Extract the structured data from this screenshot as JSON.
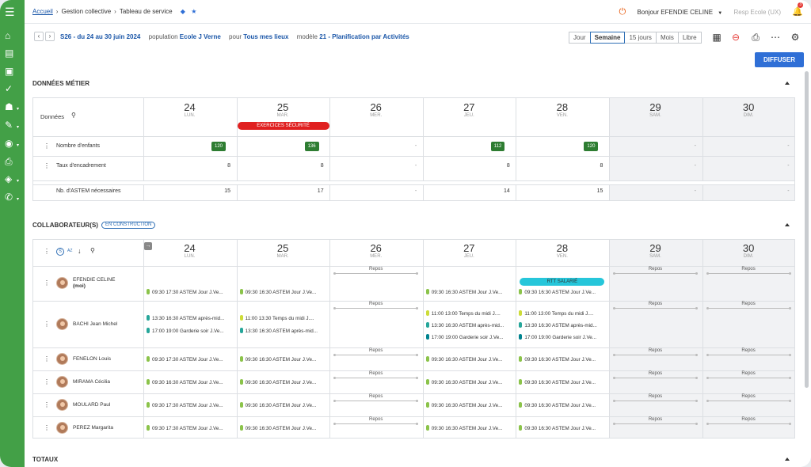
{
  "sidebar": {
    "icons": [
      "menu-icon",
      "home-icon",
      "contacts-icon",
      "gallery-icon",
      "check-icon",
      "team-icon",
      "person-edit-icon",
      "eye-icon",
      "print-icon",
      "user-shield-icon",
      "wrench-icon"
    ]
  },
  "topbar": {
    "breadcrumb": [
      "Accueil",
      "Gestion collective",
      "Tableau de service"
    ],
    "greeting": "Bonjour EFENDIE CELINE",
    "role": "Resp Ecole (UX)",
    "notif_count": "3"
  },
  "toolbar": {
    "week": "S26 - du 24 au 30 juin 2024",
    "population_label": "population",
    "population": "Ecole J Verne",
    "pour_label": "pour",
    "pour": "Tous mes lieux",
    "modele_label": "modèle",
    "modele": "21 - Planification par Activités",
    "views": [
      "Jour",
      "Semaine",
      "15 jours",
      "Mois",
      "Libre"
    ],
    "active_view": "Semaine",
    "diffuser": "DIFFUSER"
  },
  "days": [
    {
      "num": "24",
      "name": "LUN.",
      "weekend": false
    },
    {
      "num": "25",
      "name": "MAR.",
      "weekend": false
    },
    {
      "num": "26",
      "name": "MER.",
      "weekend": false
    },
    {
      "num": "27",
      "name": "JEU.",
      "weekend": false
    },
    {
      "num": "28",
      "name": "VEN.",
      "weekend": false
    },
    {
      "num": "29",
      "name": "SAM.",
      "weekend": true
    },
    {
      "num": "30",
      "name": "DIM.",
      "weekend": true
    }
  ],
  "metier": {
    "title": "DONNÉES MÉTIER",
    "header_label": "Données",
    "event": {
      "day": 1,
      "label": "EXERCICES SÉCURITÉ"
    },
    "rows": [
      {
        "label": "Nombre d'enfants",
        "badge": true,
        "values": [
          "120",
          "136",
          "-",
          "112",
          "120",
          "-",
          "-"
        ]
      },
      {
        "label": "Taux d'encadrement",
        "badge": false,
        "values": [
          "8",
          "8",
          "-",
          "8",
          "8",
          "-",
          "-"
        ]
      },
      {
        "label": "Nb. d'ASTEM nécessaires",
        "badge": false,
        "values": [
          "15",
          "17",
          "-",
          "14",
          "15",
          "-",
          "-"
        ]
      }
    ]
  },
  "collab": {
    "title": "COLLABORATEUR(S)",
    "status": "EN CONSTRUCTION",
    "tool_s": "S",
    "tool_az": "AZ",
    "employees": [
      {
        "name": "EFENDIE CELINE",
        "sub": "(moi)",
        "cells": [
          [
            {
              "c": "#8bc34a",
              "t": "09:30 17:30  ASTEM Jour J.Ve..."
            }
          ],
          [
            {
              "c": "#8bc34a",
              "t": "09:30 16:30  ASTEM Jour J.Ve..."
            }
          ],
          "Repos",
          [
            {
              "c": "#8bc34a",
              "t": "09:30 16:30  ASTEM Jour J.Ve..."
            }
          ],
          [
            {
              "rtt": "RTT SALARIÉ"
            },
            {
              "c": "#8bc34a",
              "t": "09:30 16:30  ASTEM Jour J.Ve..."
            }
          ],
          "Repos",
          "Repos"
        ]
      },
      {
        "name": "BACHI Jean Michel",
        "sub": "",
        "cells": [
          [
            {
              "c": "#26a69a",
              "t": "13:30 16:30  ASTEM après-mid..."
            },
            {
              "c": "#26a69a",
              "t": "17:00 19:00  Garderie soir J.Ve..."
            }
          ],
          [
            {
              "c": "#cddc39",
              "t": "11:00 13:30  Temps du midi J...."
            },
            {
              "c": "#26a69a",
              "t": "13:30 16:30  ASTEM après-mid..."
            }
          ],
          "Repos",
          [
            {
              "c": "#cddc39",
              "t": "11:00 13:00  Temps du midi J...."
            },
            {
              "c": "#26a69a",
              "t": "13:30 16:30  ASTEM après-mid..."
            },
            {
              "c": "#00838f",
              "t": "17:00 19:00  Garderie soir J.Ve..."
            }
          ],
          [
            {
              "c": "#cddc39",
              "t": "11:00 13:00  Temps du midi J...."
            },
            {
              "c": "#26a69a",
              "t": "13:30 16:30  ASTEM après-mid..."
            },
            {
              "c": "#00838f",
              "t": "17:00 19:00  Garderie soir J.Ve..."
            }
          ],
          "Repos",
          "Repos"
        ]
      },
      {
        "name": "FENELON Louis",
        "sub": "",
        "cells": [
          [
            {
              "c": "#8bc34a",
              "t": "09:30 17:30  ASTEM Jour J.Ve..."
            }
          ],
          [
            {
              "c": "#8bc34a",
              "t": "09:30 16:30  ASTEM Jour J.Ve..."
            }
          ],
          "Repos",
          [
            {
              "c": "#8bc34a",
              "t": "09:30 16:30  ASTEM Jour J.Ve..."
            }
          ],
          [
            {
              "c": "#8bc34a",
              "t": "09:30 16:30  ASTEM Jour J.Ve..."
            }
          ],
          "Repos",
          "Repos"
        ]
      },
      {
        "name": "MIRAMA Cécilia",
        "sub": "",
        "cells": [
          [
            {
              "c": "#8bc34a",
              "t": "09:30 16:30  ASTEM Jour J.Ve..."
            }
          ],
          [
            {
              "c": "#8bc34a",
              "t": "09:30 16:30  ASTEM Jour J.Ve..."
            }
          ],
          "Repos",
          [
            {
              "c": "#8bc34a",
              "t": "09:30 16:30  ASTEM Jour J.Ve..."
            }
          ],
          [
            {
              "c": "#8bc34a",
              "t": "09:30 16:30  ASTEM Jour J.Ve..."
            }
          ],
          "Repos",
          "Repos"
        ]
      },
      {
        "name": "MOULARD Paul",
        "sub": "",
        "cells": [
          [
            {
              "c": "#8bc34a",
              "t": "09:30 17:30  ASTEM Jour J.Ve..."
            }
          ],
          [
            {
              "c": "#8bc34a",
              "t": "09:30 16:30  ASTEM Jour J.Ve..."
            }
          ],
          "Repos",
          [
            {
              "c": "#8bc34a",
              "t": "09:30 16:30  ASTEM Jour J.Ve..."
            }
          ],
          [
            {
              "c": "#8bc34a",
              "t": "09:30 16:30  ASTEM Jour J.Ve..."
            }
          ],
          "Repos",
          "Repos"
        ]
      },
      {
        "name": "PEREZ Margarita",
        "sub": "",
        "cells": [
          [
            {
              "c": "#8bc34a",
              "t": "09:30 17:30  ASTEM Jour J.Ve..."
            }
          ],
          [
            {
              "c": "#8bc34a",
              "t": "09:30 16:30  ASTEM Jour J.Ve..."
            }
          ],
          "Repos",
          [
            {
              "c": "#8bc34a",
              "t": "09:30 16:30  ASTEM Jour J.Ve..."
            }
          ],
          [
            {
              "c": "#8bc34a",
              "t": "09:30 16:30  ASTEM Jour J.Ve..."
            }
          ],
          "Repos",
          "Repos"
        ]
      }
    ]
  },
  "totaux": {
    "title": "TOTAUX"
  }
}
